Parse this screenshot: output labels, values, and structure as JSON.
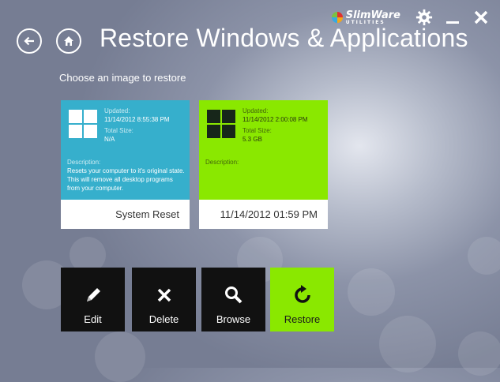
{
  "window": {
    "title": "Restore Windows & Applications",
    "brand": "SlimWare",
    "brand_sub": "UTILITIES"
  },
  "subtitle": "Choose an image to restore",
  "cards": [
    {
      "updated_label": "Updated:",
      "updated": "11/14/2012 8:55:38 PM",
      "size_label": "Total Size:",
      "size": "N/A",
      "desc_label": "Description:",
      "desc": "Resets your computer to it's original state. This will remove all desktop programs from your computer.",
      "name": "System Reset"
    },
    {
      "updated_label": "Updated:",
      "updated": "11/14/2012 2:00:08 PM",
      "size_label": "Total Size:",
      "size": "5.3 GB",
      "desc_label": "Description:",
      "desc": "",
      "name": "11/14/2012 01:59 PM"
    }
  ],
  "actions": {
    "edit": "Edit",
    "delete": "Delete",
    "browse": "Browse",
    "restore": "Restore"
  },
  "icons": [
    "back-arrow-icon",
    "home-icon",
    "gear-icon",
    "minimize-icon",
    "close-icon",
    "windows-logo-icon",
    "pencil-icon",
    "x-icon",
    "magnifier-icon",
    "refresh-icon"
  ],
  "colors": {
    "accent_green": "#8ae800",
    "reset_blue": "#36afcc",
    "tile_dark": "#111111"
  }
}
